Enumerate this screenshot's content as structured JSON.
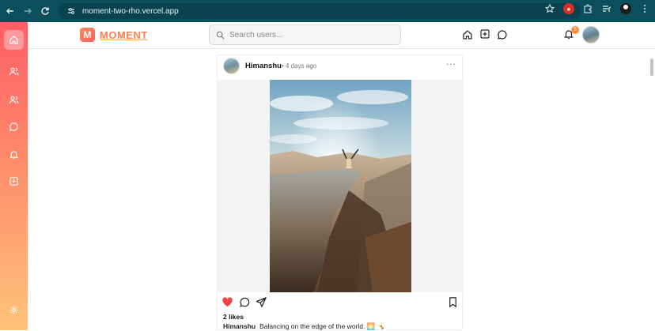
{
  "browser": {
    "url": "moment-two-rho.vercel.app"
  },
  "app": {
    "logo_letter": "M",
    "logo_text": "MOMENT",
    "search_placeholder": "Search users...",
    "notification_count": "5"
  },
  "sidebar": {
    "items": [
      {
        "icon": "home-icon"
      },
      {
        "icon": "users-icon"
      },
      {
        "icon": "users-alt-icon"
      },
      {
        "icon": "chat-icon"
      },
      {
        "icon": "bell-icon"
      },
      {
        "icon": "plus-square-icon"
      },
      {
        "icon": "gear-icon"
      }
    ]
  },
  "post": {
    "username": "Himanshu",
    "time": "• 4 days ago",
    "more": "···",
    "likes": "2 likes",
    "caption_user": "Himanshu",
    "caption_text": "Balancing on the edge of the world. 🌅 🤸"
  },
  "colors": {
    "brand": "#ff7f50",
    "like": "#ef4444",
    "chrome": "#0b4f5c"
  }
}
